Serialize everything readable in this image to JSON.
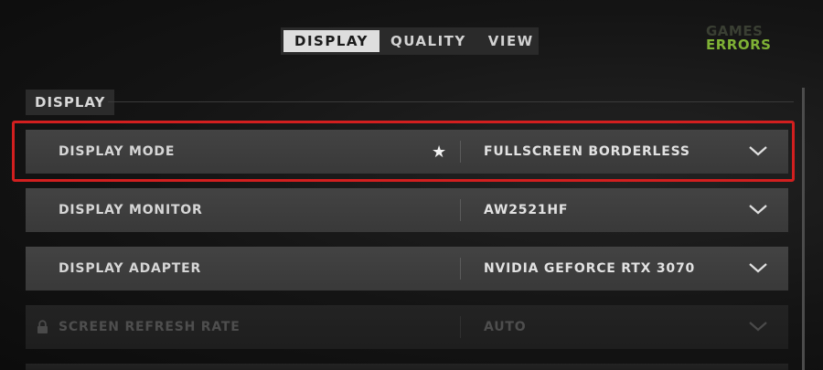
{
  "tabs": [
    {
      "label": "DISPLAY",
      "active": true
    },
    {
      "label": "QUALITY",
      "active": false
    },
    {
      "label": "VIEW",
      "active": false
    }
  ],
  "watermark": {
    "line1": "GAMES",
    "line2": "ERRORS"
  },
  "section": {
    "title": "DISPLAY"
  },
  "settings": [
    {
      "label": "DISPLAY MODE",
      "value": "FULLSCREEN BORDERLESS",
      "favorite_icon": "star-icon",
      "highlighted": true
    },
    {
      "label": "DISPLAY MONITOR",
      "value": "AW2521HF"
    },
    {
      "label": "DISPLAY ADAPTER",
      "value": "NVIDIA GEFORCE RTX 3070"
    },
    {
      "label": "SCREEN REFRESH RATE",
      "value": "AUTO",
      "locked": true,
      "lock_icon": "lock-icon"
    }
  ],
  "colors": {
    "highlight": "#d21f1f",
    "watermark_accent": "#7fb135",
    "active_tab": "#dedede"
  }
}
